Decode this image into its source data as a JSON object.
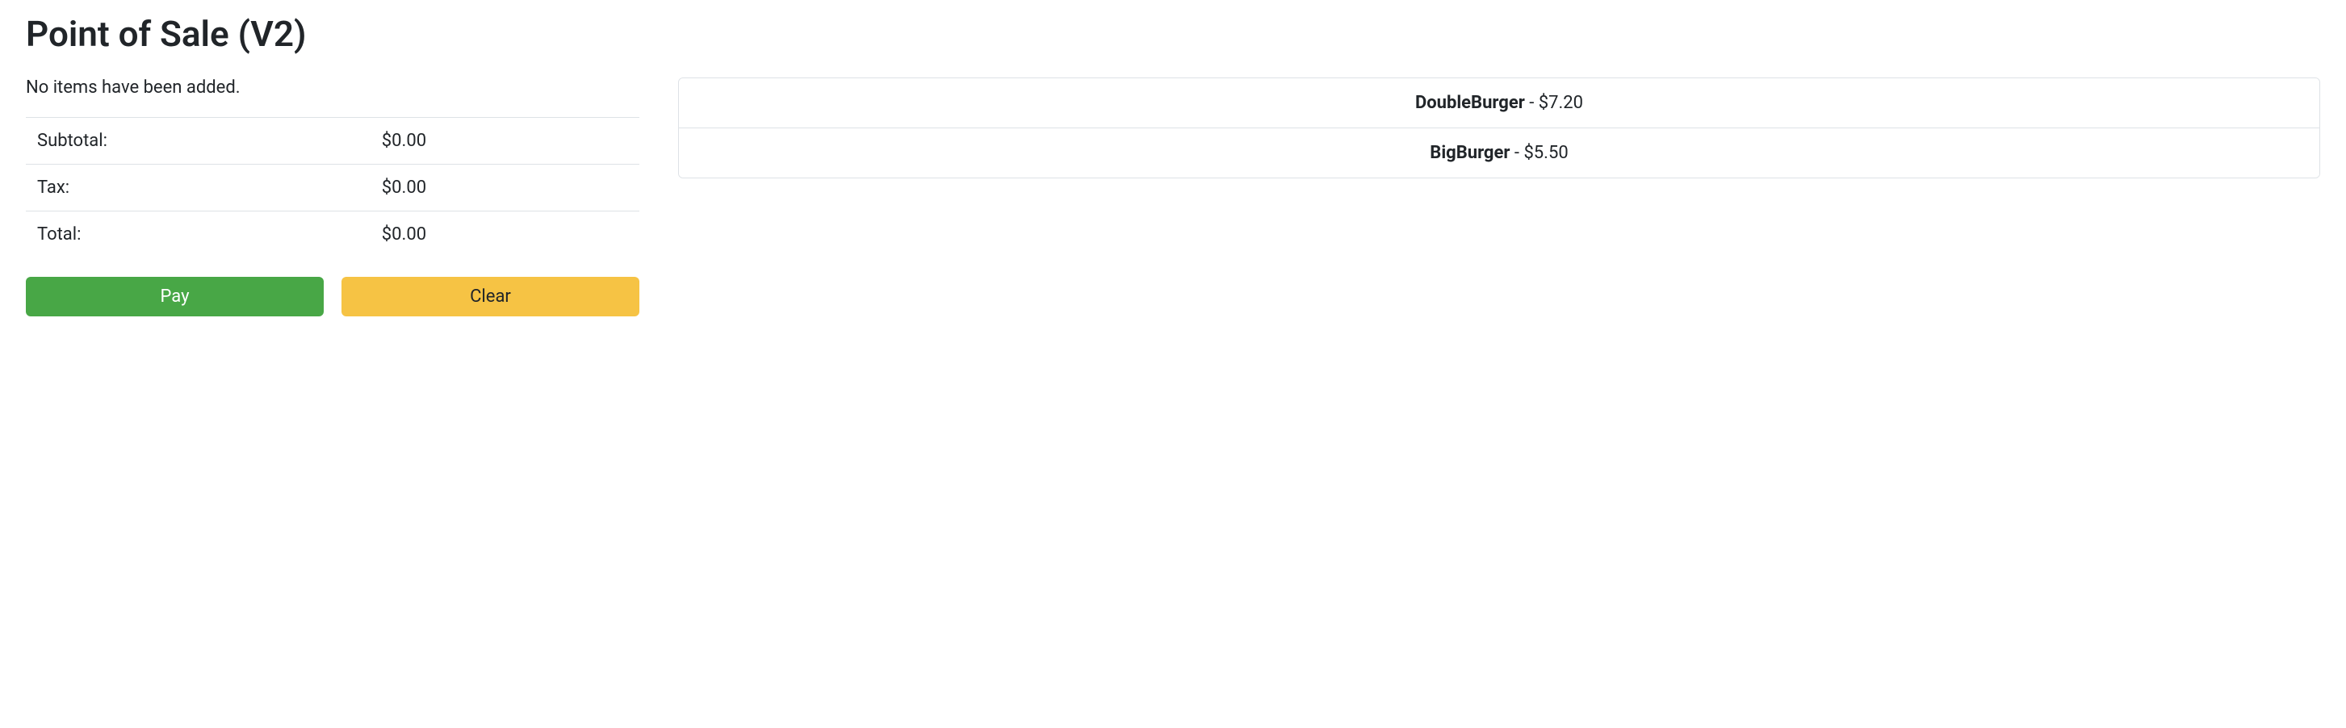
{
  "header": {
    "title": "Point of Sale (V2)"
  },
  "cart": {
    "empty_message": "No items have been added.",
    "totals": {
      "subtotal_label": "Subtotal:",
      "subtotal_value": "$0.00",
      "tax_label": "Tax:",
      "tax_value": "$0.00",
      "total_label": "Total:",
      "total_value": "$0.00"
    },
    "buttons": {
      "pay": "Pay",
      "clear": "Clear"
    }
  },
  "products": [
    {
      "name": "DoubleBurger",
      "sep": " - ",
      "price": "$7.20"
    },
    {
      "name": "BigBurger",
      "sep": " - ",
      "price": "$5.50"
    }
  ]
}
